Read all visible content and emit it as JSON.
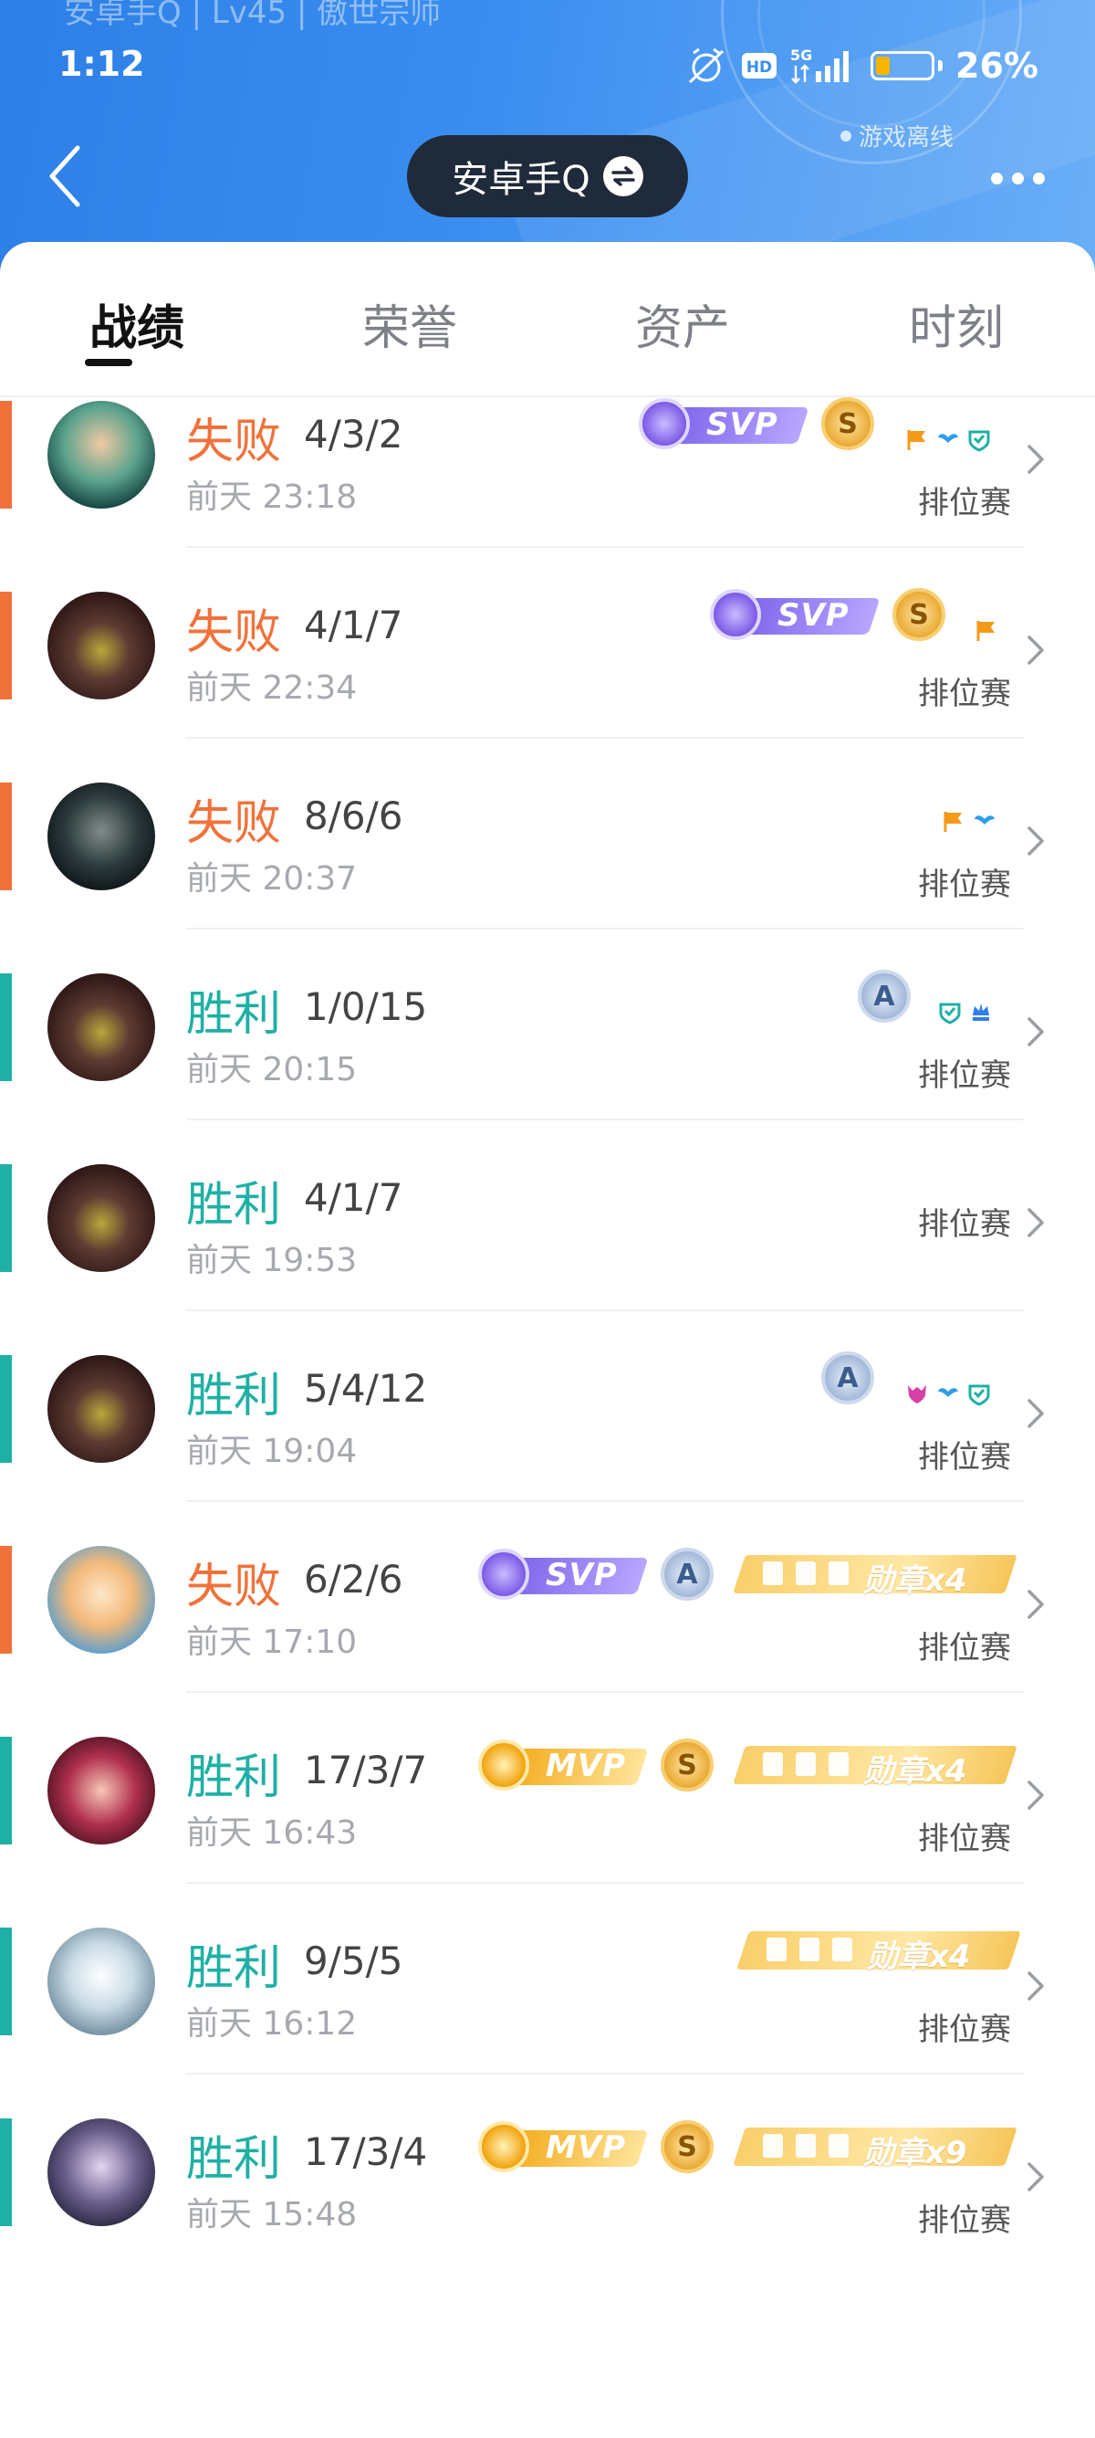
{
  "status": {
    "time": "1:12",
    "battery": "26%",
    "network": "5G",
    "hd": "HD"
  },
  "header": {
    "ghost_title": "安卓手Q | Lv45 | 傲世宗师",
    "account_name": "安卓手Q",
    "offline_text": "游戏离线"
  },
  "tabs": [
    "战绩",
    "荣誉",
    "资产",
    "时刻"
  ],
  "mode_label": "排位赛",
  "colors": {
    "lose": "#f0723a",
    "win": "#1fb0a5",
    "header": "#3b8ef0"
  },
  "matches": [
    {
      "result": "失败",
      "kda": "4/3/2",
      "time": "前天 23:18",
      "svp": "SVP",
      "coin": "S",
      "icons": [
        "flag-icon",
        "wings-icon",
        "shield-icon"
      ]
    },
    {
      "result": "失败",
      "kda": "4/1/7",
      "time": "前天 22:34",
      "svp": "SVP",
      "coin": "S",
      "icons": [
        "flag-icon"
      ]
    },
    {
      "result": "失败",
      "kda": "8/6/6",
      "time": "前天 20:37",
      "icons": [
        "flag-icon",
        "wings-icon"
      ]
    },
    {
      "result": "胜利",
      "kda": "1/0/15",
      "time": "前天 20:15",
      "coin": "A",
      "icons": [
        "shield-icon",
        "crown-icon"
      ]
    },
    {
      "result": "胜利",
      "kda": "4/1/7",
      "time": "前天 19:53"
    },
    {
      "result": "胜利",
      "kda": "5/4/12",
      "time": "前天 19:04",
      "coin": "A",
      "icons": [
        "demon-icon",
        "wings-icon",
        "shield-icon"
      ]
    },
    {
      "result": "失败",
      "kda": "6/2/6",
      "time": "前天 17:10",
      "svp": "SVP",
      "coin": "A",
      "medal": "勋章x4"
    },
    {
      "result": "胜利",
      "kda": "17/3/7",
      "time": "前天 16:43",
      "mvp": "MVP",
      "coin": "S",
      "medal": "勋章x4"
    },
    {
      "result": "胜利",
      "kda": "9/5/5",
      "time": "前天 16:12",
      "medal": "勋章x4"
    },
    {
      "result": "胜利",
      "kda": "17/3/4",
      "time": "前天 15:48",
      "mvp": "MVP",
      "coin": "S",
      "medal": "勋章x9"
    }
  ]
}
